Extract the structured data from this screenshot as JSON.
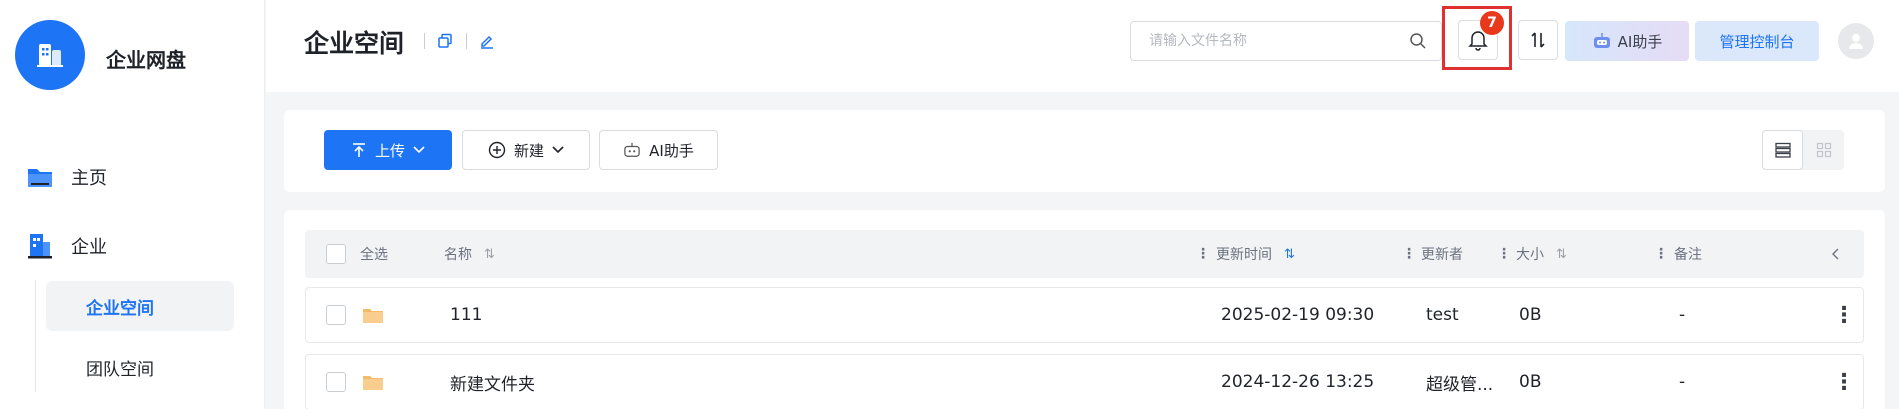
{
  "app": {
    "name": "企业网盘"
  },
  "sidebar": {
    "items": [
      {
        "label": "主页",
        "icon": "folder-icon"
      },
      {
        "label": "企业",
        "icon": "building-icon"
      }
    ],
    "sub_items": [
      {
        "label": "企业空间",
        "active": true
      },
      {
        "label": "团队空间",
        "active": false
      }
    ]
  },
  "header": {
    "title": "企业空间",
    "search_placeholder": "请输入文件名称",
    "notification_count": "7",
    "ai_label": "AI助手",
    "admin_label": "管理控制台"
  },
  "toolbar": {
    "upload_label": "上传",
    "new_label": "新建",
    "ai_label": "AI助手"
  },
  "table": {
    "select_all": "全选",
    "columns": {
      "name": "名称",
      "updated": "更新时间",
      "updater": "更新者",
      "size": "大小",
      "note": "备注"
    },
    "rows": [
      {
        "name": "111",
        "updated": "2025-02-19 09:30",
        "updater": "test",
        "size": "0B",
        "note": "-"
      },
      {
        "name": "新建文件夹",
        "updated": "2024-12-26 13:25",
        "updater": "超级管...",
        "size": "0B",
        "note": "-"
      }
    ]
  },
  "colors": {
    "primary": "#1d74f5",
    "badge": "#e8391c",
    "highlight_box": "#e03131",
    "folder": "#f5b968"
  }
}
